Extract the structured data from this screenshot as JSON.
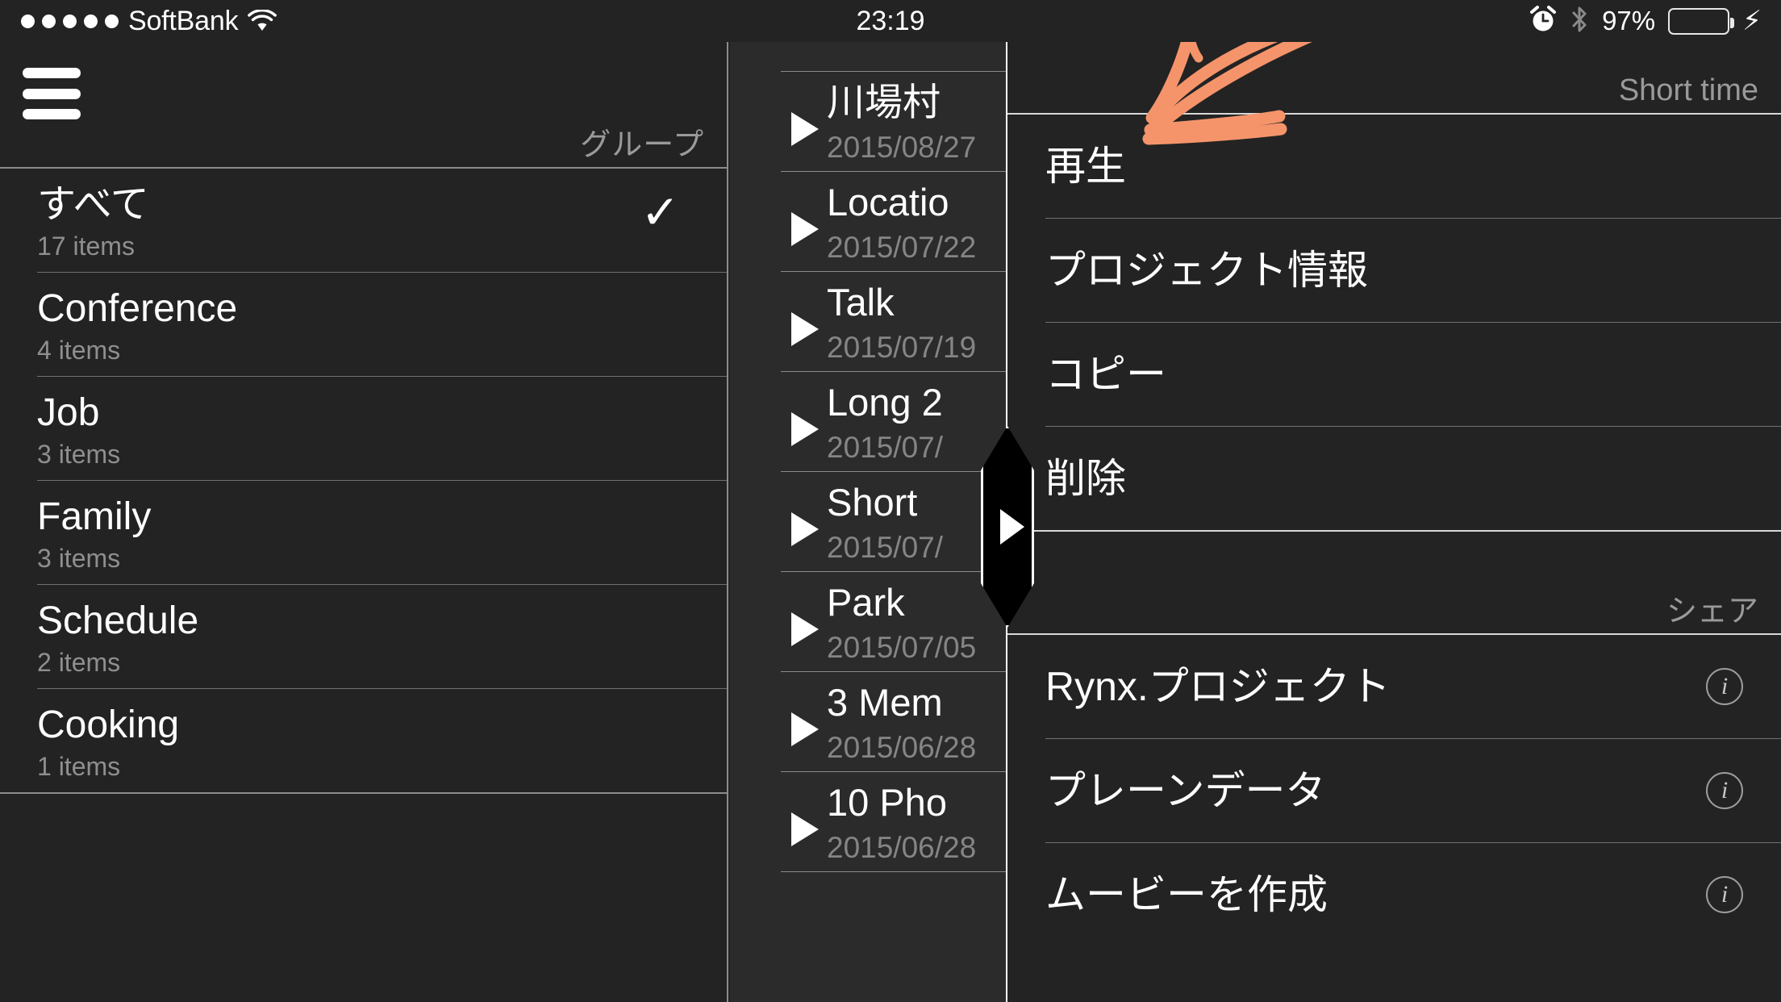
{
  "status_bar": {
    "signal_dots": 5,
    "carrier": "SoftBank",
    "wifi_icon": "wifi-icon",
    "time": "23:19",
    "alarm_icon": "alarm-clock-icon",
    "bluetooth_icon": "bluetooth-icon",
    "battery_percent": "97%",
    "battery_level": 97,
    "battery_color": "#4CD964",
    "charging_icon": "lightning-bolt-icon"
  },
  "sidebar": {
    "menu_icon": "hamburger-menu-icon",
    "section_header": "グループ",
    "items": [
      {
        "name": "すべて",
        "count": "17 items",
        "selected": true,
        "check_icon": "checkmark-icon"
      },
      {
        "name": "Conference",
        "count": "4 items",
        "selected": false
      },
      {
        "name": "Job",
        "count": "3 items",
        "selected": false
      },
      {
        "name": "Family",
        "count": "3 items",
        "selected": false
      },
      {
        "name": "Schedule",
        "count": "2 items",
        "selected": false
      },
      {
        "name": "Cooking",
        "count": "1 items",
        "selected": false
      }
    ]
  },
  "project_list": {
    "play_icon": "play-triangle-icon",
    "items": [
      {
        "title": "川場村",
        "date": "2015/08/27"
      },
      {
        "title": "Locatio",
        "date": "2015/07/22"
      },
      {
        "title": "Talk",
        "date": "2015/07/19"
      },
      {
        "title": "Long 2",
        "date": "2015/07/"
      },
      {
        "title": "Short",
        "date": "2015/07/"
      },
      {
        "title": "Park",
        "date": "2015/07/05"
      },
      {
        "title": "3 Mem",
        "date": "2015/06/28"
      },
      {
        "title": "10 Pho",
        "date": "2015/06/28"
      }
    ]
  },
  "panel": {
    "header_title": "Short time",
    "actions": [
      {
        "label": "再生"
      },
      {
        "label": "プロジェクト情報"
      },
      {
        "label": "コピー"
      },
      {
        "label": "削除"
      }
    ],
    "share_header": "シェア",
    "share_items": [
      {
        "label": "Rynx.プロジェクト",
        "info_icon": "info-circle-icon"
      },
      {
        "label": "プレーンデータ",
        "info_icon": "info-circle-icon"
      },
      {
        "label": "ムービーを作成",
        "info_icon": "info-circle-icon"
      }
    ]
  },
  "handle": {
    "icon": "drag-handle-right-arrow-icon"
  },
  "annotation": {
    "type": "hand-drawn-arrow",
    "color": "#F5946B",
    "points_at": "再生"
  }
}
